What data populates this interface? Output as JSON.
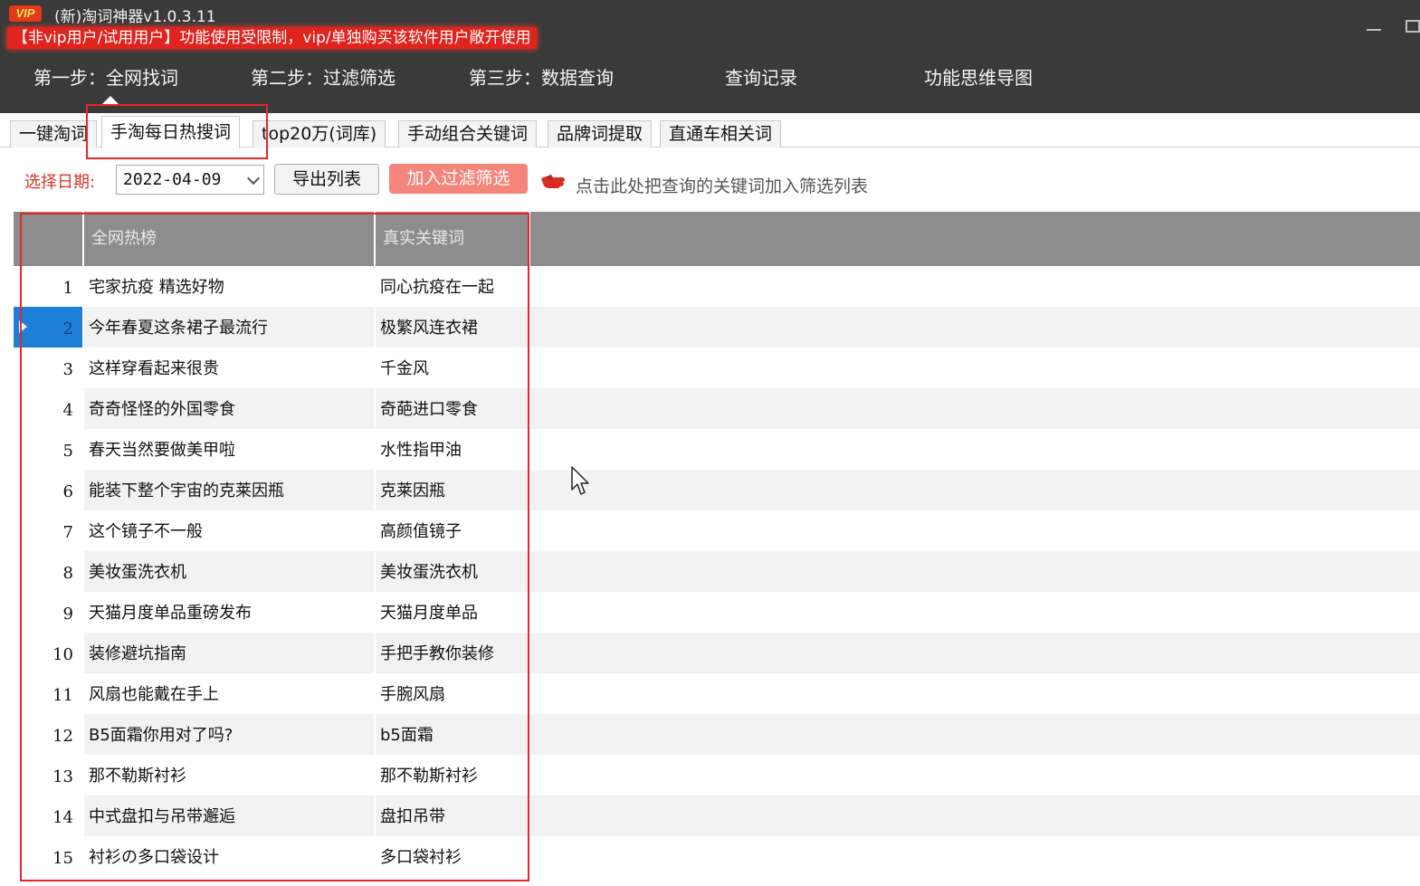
{
  "window": {
    "logo_text": "VIP",
    "title": "(新)淘词神器v1.0.3.11",
    "warning": "【非vip用户/试用用户】功能使用受限制，vip/单独购买该软件用户敞开使用"
  },
  "nav": {
    "items": [
      {
        "label": "第一步：全网找词"
      },
      {
        "label": "第二步：过滤筛选"
      },
      {
        "label": "第三步：数据查询"
      },
      {
        "label": "查询记录"
      },
      {
        "label": "功能思维导图"
      }
    ],
    "active_index": 0
  },
  "subtabs": {
    "items": [
      {
        "label": "一键淘词"
      },
      {
        "label": "手淘每日热搜词"
      },
      {
        "label": "top20万(词库)"
      },
      {
        "label": "手动组合关键词"
      },
      {
        "label": "品牌词提取"
      },
      {
        "label": "直通车相关词"
      }
    ],
    "active_index": 1
  },
  "toolbar": {
    "date_label": "选择日期:",
    "date_value": "2022-04-09",
    "export_label": "导出列表",
    "add_filter_label": "加入过滤筛选",
    "hint": "点击此处把查询的关键词加入筛选列表"
  },
  "grid": {
    "columns": [
      "全网热榜",
      "真实关键词"
    ],
    "selected_row": 2,
    "rows": [
      {
        "n": "1",
        "hot": "宅家抗疫 精选好物",
        "keyword": "同心抗疫在一起"
      },
      {
        "n": "2",
        "hot": "今年春夏这条裙子最流行",
        "keyword": "极繁风连衣裙"
      },
      {
        "n": "3",
        "hot": "这样穿看起来很贵",
        "keyword": "千金风"
      },
      {
        "n": "4",
        "hot": "奇奇怪怪的外国零食",
        "keyword": "奇葩进口零食"
      },
      {
        "n": "5",
        "hot": "春天当然要做美甲啦",
        "keyword": "水性指甲油"
      },
      {
        "n": "6",
        "hot": "能装下整个宇宙的克莱因瓶",
        "keyword": "克莱因瓶"
      },
      {
        "n": "7",
        "hot": "这个镜子不一般",
        "keyword": "高颜值镜子"
      },
      {
        "n": "8",
        "hot": "美妆蛋洗衣机",
        "keyword": "美妆蛋洗衣机"
      },
      {
        "n": "9",
        "hot": "天猫月度单品重磅发布",
        "keyword": "天猫月度单品"
      },
      {
        "n": "10",
        "hot": "装修避坑指南",
        "keyword": "手把手教你装修"
      },
      {
        "n": "11",
        "hot": "风扇也能戴在手上",
        "keyword": "手腕风扇"
      },
      {
        "n": "12",
        "hot": "B5面霜你用对了吗?",
        "keyword": "b5面霜"
      },
      {
        "n": "13",
        "hot": "那不勒斯衬衫",
        "keyword": "那不勒斯衬衫"
      },
      {
        "n": "14",
        "hot": "中式盘扣与吊带邂逅",
        "keyword": "盘扣吊带"
      },
      {
        "n": "15",
        "hot": "衬衫の多口袋设计",
        "keyword": "多口袋衬衫"
      }
    ]
  },
  "colors": {
    "titlebar_bg": "#3a3a3a",
    "warning_bg": "#e0231d",
    "add_button_bg": "#f5857b",
    "highlight_frame": "#e8262a",
    "grid_header_bg": "#8d8d8d",
    "selected_row_bg": "#1e7fd6"
  },
  "icons": {
    "hand": "pointing-hand-icon",
    "dropdown": "chevron-down-icon",
    "row_selector": "triangle-right-icon",
    "cursor": "mouse-pointer-icon"
  }
}
